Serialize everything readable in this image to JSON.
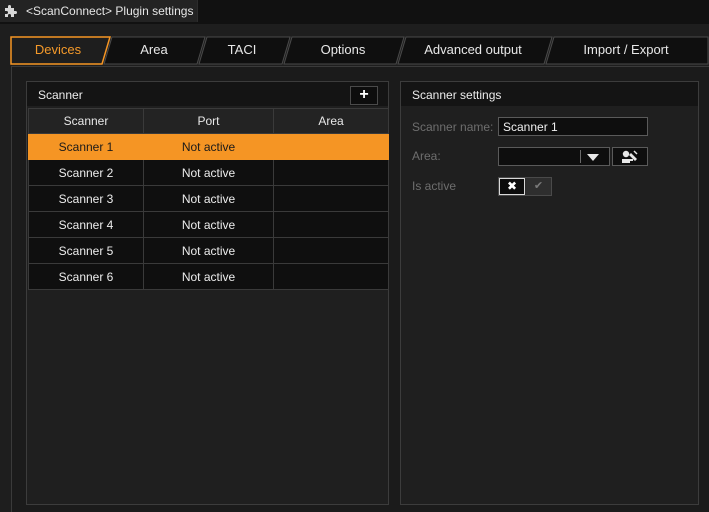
{
  "window": {
    "title": "<ScanConnect> Plugin settings",
    "icon": "puzzle-icon"
  },
  "tabs": [
    {
      "label": "Devices",
      "active": true
    },
    {
      "label": "Area",
      "active": false
    },
    {
      "label": "TACI",
      "active": false
    },
    {
      "label": "Options",
      "active": false
    },
    {
      "label": "Advanced output",
      "active": false
    },
    {
      "label": "Import / Export",
      "active": false
    }
  ],
  "scanner_panel": {
    "title": "Scanner",
    "add_label": "+",
    "columns": [
      "Scanner",
      "Port",
      "Area"
    ],
    "rows": [
      {
        "scanner": "Scanner 1",
        "port": "Not active",
        "area": "",
        "selected": true
      },
      {
        "scanner": "Scanner 2",
        "port": "Not active",
        "area": ""
      },
      {
        "scanner": "Scanner 3",
        "port": "Not active",
        "area": ""
      },
      {
        "scanner": "Scanner 4",
        "port": "Not active",
        "area": ""
      },
      {
        "scanner": "Scanner 5",
        "port": "Not active",
        "area": ""
      },
      {
        "scanner": "Scanner 6",
        "port": "Not active",
        "area": ""
      }
    ]
  },
  "settings_panel": {
    "title": "Scanner settings",
    "name_label": "Scanner name:",
    "name_value": "Scanner 1",
    "area_label": "Area:",
    "area_value": "",
    "active_label": "Is active",
    "active_off_glyph": "✖",
    "active_on_glyph": "✔",
    "is_active": false
  },
  "colors": {
    "accent": "#f59524",
    "background": "#1e1e1e",
    "panel_header": "#141414"
  }
}
